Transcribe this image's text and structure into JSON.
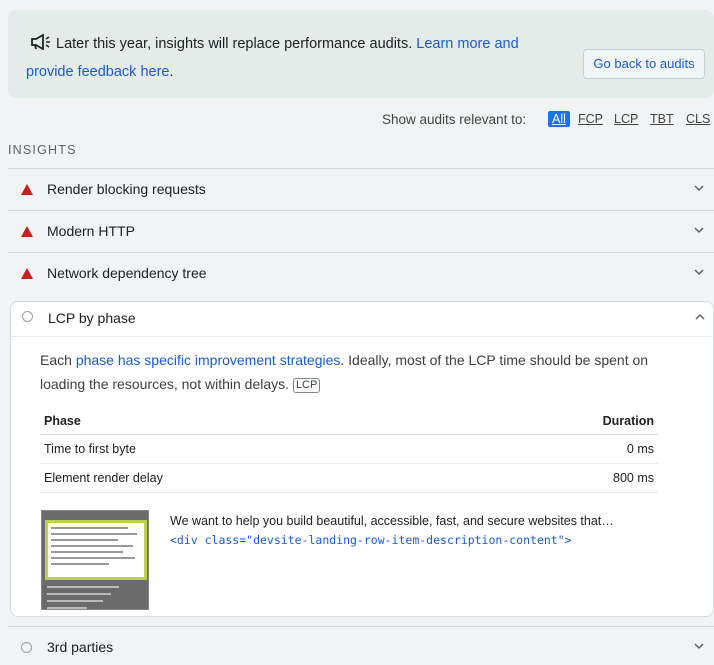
{
  "banner": {
    "message": "Later this year, insights will replace performance audits.",
    "link": "Learn more and provide feedback here",
    "period": ".",
    "back_button": "Go back to audits"
  },
  "filter": {
    "label": "Show audits relevant to:",
    "options": [
      "All",
      "FCP",
      "LCP",
      "TBT",
      "CLS"
    ],
    "selected": "All"
  },
  "insights_heading": "INSIGHTS",
  "audits": [
    {
      "title": "Render blocking requests",
      "status": "fail"
    },
    {
      "title": "Modern HTTP",
      "status": "fail"
    },
    {
      "title": "Network dependency tree",
      "status": "fail"
    }
  ],
  "lcp": {
    "title": "LCP by phase",
    "desc_prefix": "Each ",
    "desc_link": "phase has specific improvement strategies",
    "desc_suffix": ". Ideally, most of the LCP time should be spent on loading the resources, not within delays.",
    "tag": "LCP",
    "table": {
      "headers": [
        "Phase",
        "Duration"
      ],
      "rows": [
        {
          "phase": "Time to first byte",
          "duration": "0 ms"
        },
        {
          "phase": "Element render delay",
          "duration": "800 ms"
        }
      ]
    },
    "element_snippet": "We want to help you build beautiful, accessible, fast, and secure websites that…",
    "element_code": "<div class=\"devsite-landing-row-item-description-content\">"
  },
  "next_audit": {
    "title": "3rd parties"
  },
  "colors": {
    "fail": "#c5221f",
    "link": "#1a5bd6",
    "accent": "#1a73e8"
  }
}
